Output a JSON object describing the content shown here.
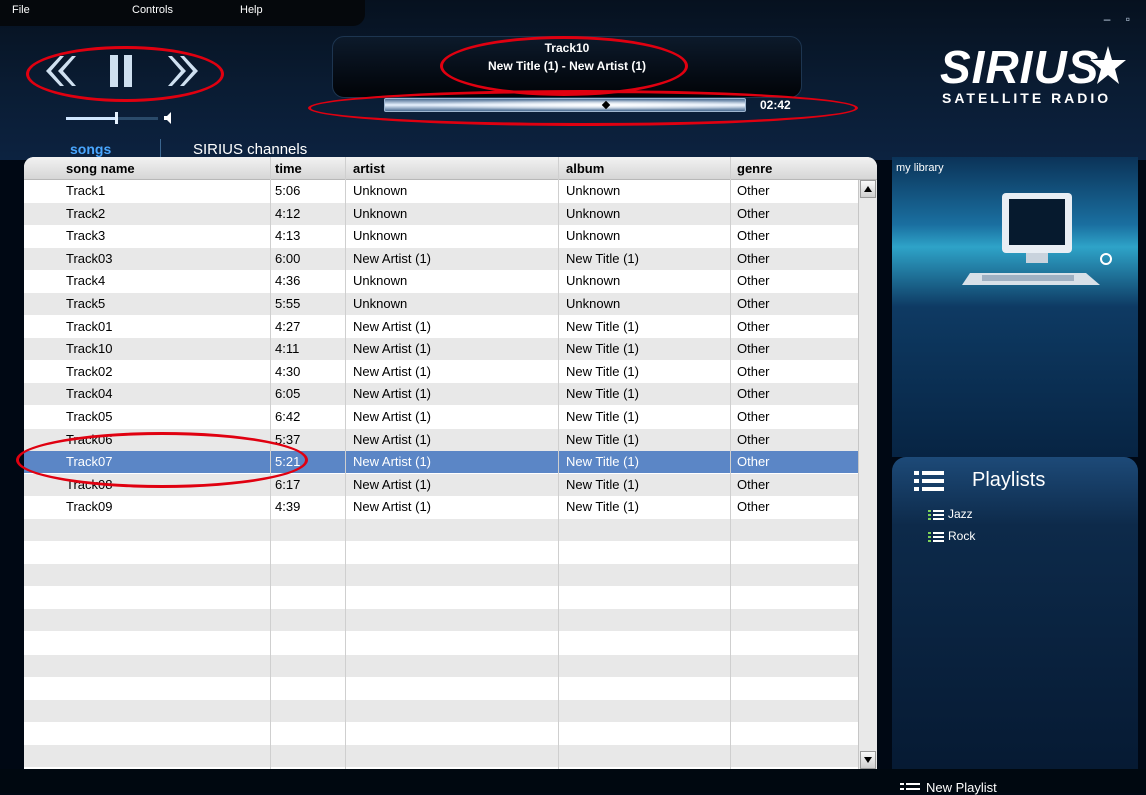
{
  "menu": {
    "file": "File",
    "controls": "Controls",
    "help": "Help"
  },
  "window_controls": "– ▫",
  "now_playing": {
    "title": "Track10",
    "subtitle": "New Title (1)  - New Artist (1)",
    "progress": 0.61,
    "elapsed": "02:42"
  },
  "volume": {
    "level": 0.54
  },
  "logo": {
    "word": "SIRIUS",
    "sub": "SATELLITE RADIO"
  },
  "tabs": {
    "songs": "songs",
    "channels": "SIRIUS channels"
  },
  "table": {
    "columns": [
      "song name",
      "time",
      "artist",
      "album",
      "genre"
    ],
    "selected_index": 12,
    "rows": [
      [
        "Track1",
        "5:06",
        "Unknown",
        "Unknown",
        "Other"
      ],
      [
        "Track2",
        "4:12",
        "Unknown",
        "Unknown",
        "Other"
      ],
      [
        "Track3",
        "4:13",
        "Unknown",
        "Unknown",
        "Other"
      ],
      [
        "Track03",
        "6:00",
        "New Artist (1)",
        "New Title (1)",
        "Other"
      ],
      [
        "Track4",
        "4:36",
        "Unknown",
        "Unknown",
        "Other"
      ],
      [
        "Track5",
        "5:55",
        "Unknown",
        "Unknown",
        "Other"
      ],
      [
        "Track01",
        "4:27",
        "New Artist (1)",
        "New Title (1)",
        "Other"
      ],
      [
        "Track10",
        "4:11",
        "New Artist (1)",
        "New Title (1)",
        "Other"
      ],
      [
        "Track02",
        "4:30",
        "New Artist (1)",
        "New Title (1)",
        "Other"
      ],
      [
        "Track04",
        "6:05",
        "New Artist (1)",
        "New Title (1)",
        "Other"
      ],
      [
        "Track05",
        "6:42",
        "New Artist (1)",
        "New Title (1)",
        "Other"
      ],
      [
        "Track06",
        "5:37",
        "New Artist (1)",
        "New Title (1)",
        "Other"
      ],
      [
        "Track07",
        "5:21",
        "New Artist (1)",
        "New Title (1)",
        "Other"
      ],
      [
        "Track08",
        "6:17",
        "New Artist (1)",
        "New Title (1)",
        "Other"
      ],
      [
        "Track09",
        "4:39",
        "New Artist (1)",
        "New Title (1)",
        "Other"
      ]
    ]
  },
  "library": {
    "label": "my library"
  },
  "playlists": {
    "title": "Playlists",
    "items": [
      "Jazz",
      "Rock"
    ],
    "new_label": "New Playlist"
  },
  "colors": {
    "accent": "#4aa7ff",
    "selection": "#5b86c6",
    "annotation": "#e00010"
  }
}
